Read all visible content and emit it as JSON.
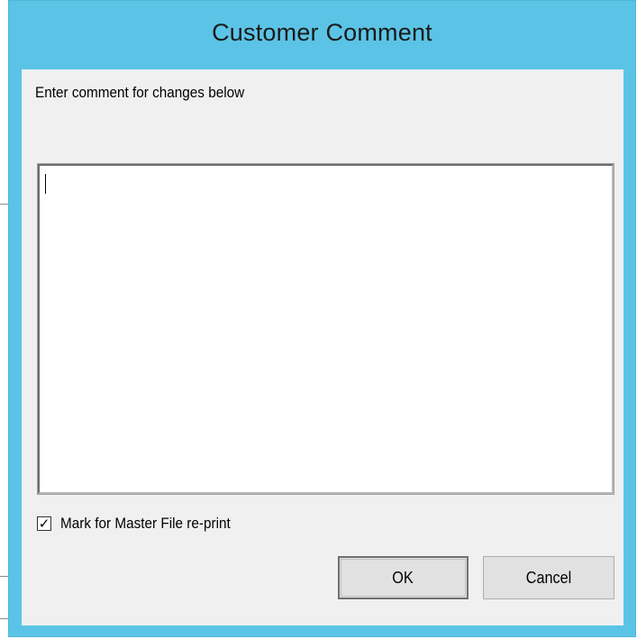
{
  "dialog": {
    "title": "Customer Comment",
    "prompt": "Enter comment for changes below",
    "comment_value": "",
    "checkbox": {
      "label": "Mark for Master File re-print",
      "checked": true,
      "mark": "✓"
    },
    "buttons": {
      "ok_label": "OK",
      "cancel_label": "Cancel"
    }
  },
  "colors": {
    "titlebar": "#5bc4e6",
    "client": "#f0f0f0",
    "button_face": "#e1e1e1"
  }
}
